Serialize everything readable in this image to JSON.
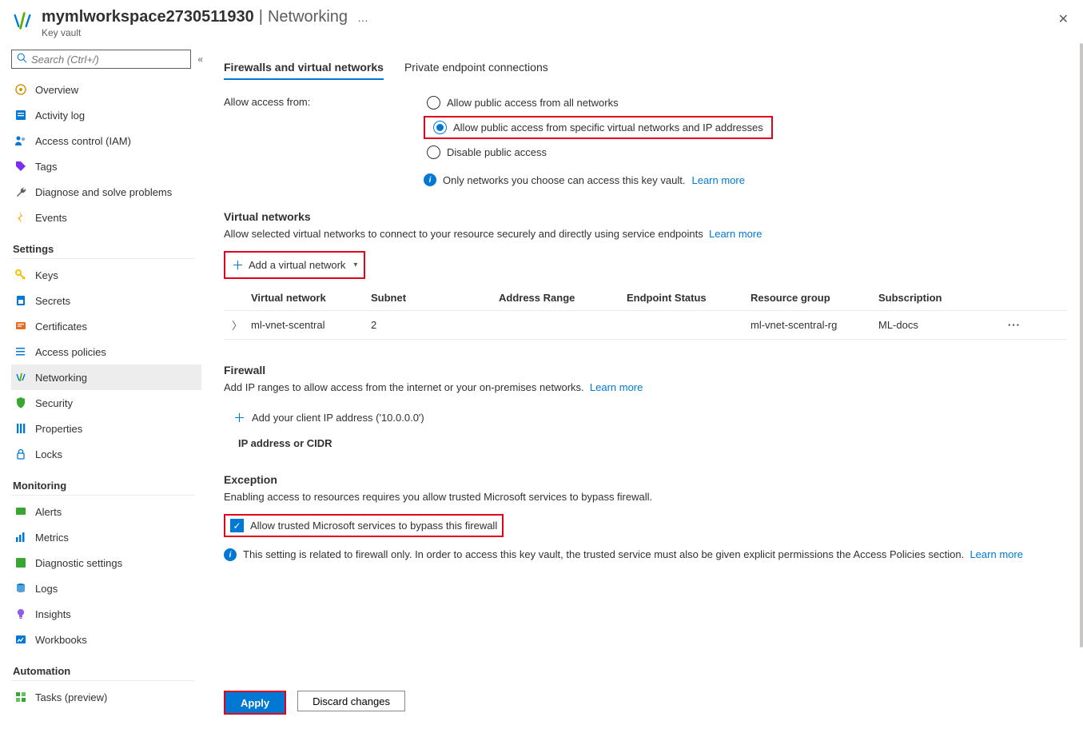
{
  "header": {
    "title": "mymlworkspace2730511930",
    "section": "Networking",
    "subtitle": "Key vault",
    "more": "…"
  },
  "search": {
    "placeholder": "Search (Ctrl+/)"
  },
  "nav": {
    "top": [
      {
        "label": "Overview"
      },
      {
        "label": "Activity log"
      },
      {
        "label": "Access control (IAM)"
      },
      {
        "label": "Tags"
      },
      {
        "label": "Diagnose and solve problems"
      },
      {
        "label": "Events"
      }
    ],
    "groups": [
      {
        "title": "Settings",
        "items": [
          {
            "label": "Keys"
          },
          {
            "label": "Secrets"
          },
          {
            "label": "Certificates"
          },
          {
            "label": "Access policies"
          },
          {
            "label": "Networking",
            "selected": true
          },
          {
            "label": "Security"
          },
          {
            "label": "Properties"
          },
          {
            "label": "Locks"
          }
        ]
      },
      {
        "title": "Monitoring",
        "items": [
          {
            "label": "Alerts"
          },
          {
            "label": "Metrics"
          },
          {
            "label": "Diagnostic settings"
          },
          {
            "label": "Logs"
          },
          {
            "label": "Insights"
          },
          {
            "label": "Workbooks"
          }
        ]
      },
      {
        "title": "Automation",
        "items": [
          {
            "label": "Tasks (preview)"
          }
        ]
      }
    ]
  },
  "tabs": {
    "firewalls": "Firewalls and virtual networks",
    "private": "Private endpoint connections"
  },
  "access": {
    "label": "Allow access from:",
    "options": {
      "all": "Allow public access from all networks",
      "specific": "Allow public access from specific virtual networks and IP addresses",
      "disable": "Disable public access"
    },
    "info": "Only networks you choose can access this key vault.",
    "learn": "Learn more"
  },
  "vnet": {
    "title": "Virtual networks",
    "desc": "Allow selected virtual networks to connect to your resource securely and directly using service endpoints",
    "learn": "Learn more",
    "add": "Add a virtual network",
    "columns": {
      "vn": "Virtual network",
      "subnet": "Subnet",
      "range": "Address Range",
      "status": "Endpoint Status",
      "rg": "Resource group",
      "sub": "Subscription"
    },
    "rows": [
      {
        "vn": "ml-vnet-scentral",
        "subnet": "2",
        "range": "",
        "status": "",
        "rg": "ml-vnet-scentral-rg",
        "sub": "ML-docs"
      }
    ]
  },
  "firewall": {
    "title": "Firewall",
    "desc": "Add IP ranges to allow access from the internet or your on-premises networks.",
    "learn": "Learn more",
    "add_ip": "Add your client IP address ('10.0.0.0')",
    "ip_label": "IP address or CIDR"
  },
  "exception": {
    "title": "Exception",
    "desc": "Enabling access to resources requires you allow trusted Microsoft services to bypass firewall.",
    "checkbox": "Allow trusted Microsoft services to bypass this firewall",
    "info": "This setting is related to firewall only. In order to access this key vault, the trusted service must also be given explicit permissions the Access Policies section.",
    "learn": "Learn more"
  },
  "footer": {
    "apply": "Apply",
    "discard": "Discard changes"
  }
}
